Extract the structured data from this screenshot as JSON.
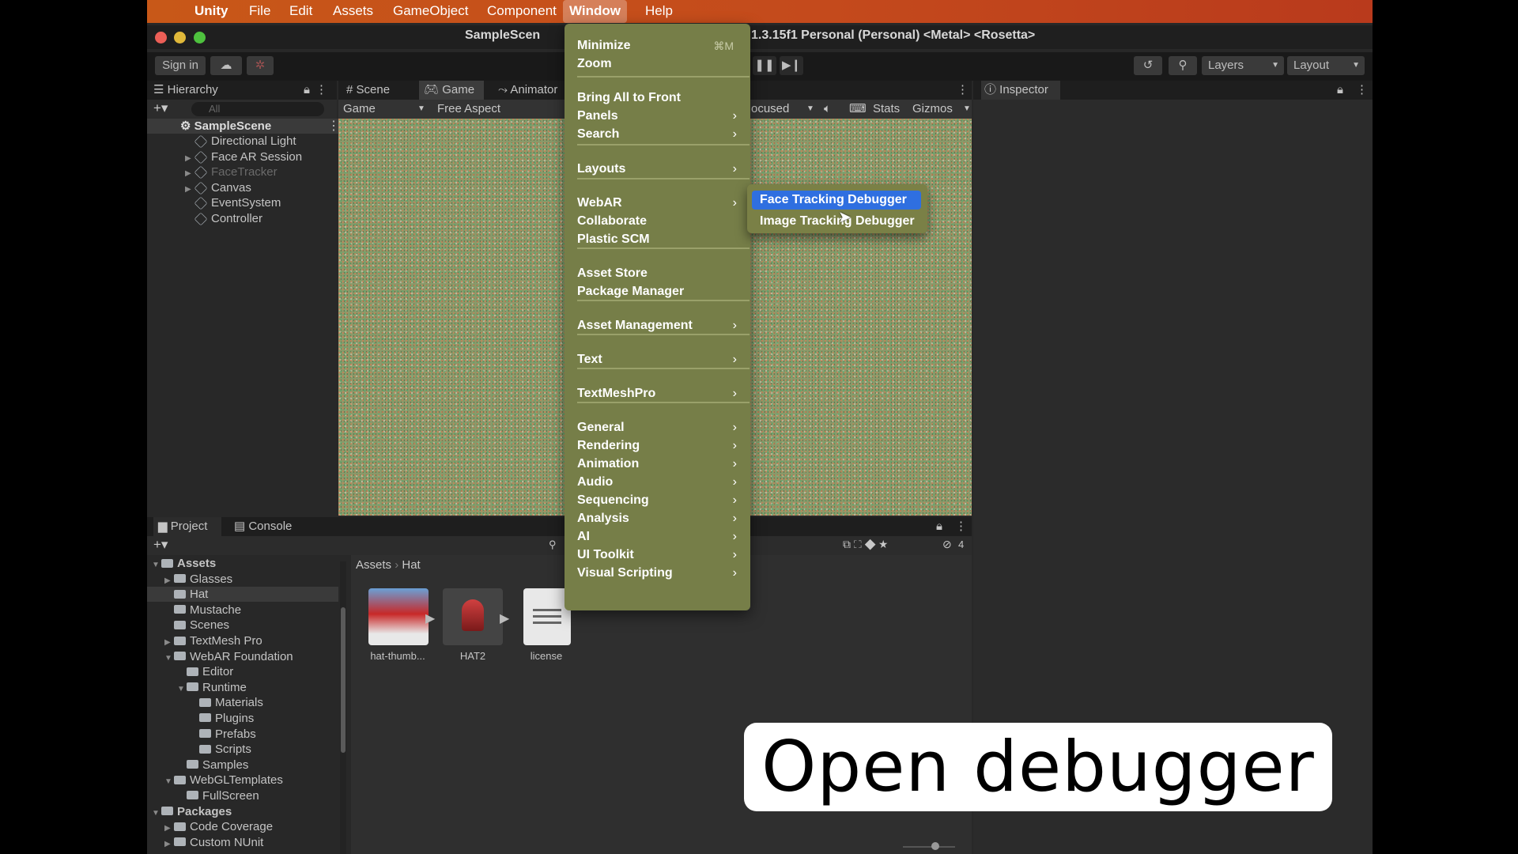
{
  "menubar": {
    "app": "Unity",
    "items": [
      "File",
      "Edit",
      "Assets",
      "GameObject",
      "Component",
      "Window",
      "Help"
    ]
  },
  "window": {
    "title_left": "SampleScen",
    "title_right": "1.3.15f1 Personal (Personal) <Metal> <Rosetta>"
  },
  "toolbar": {
    "sign_in": "Sign in",
    "layers": "Layers",
    "layout": "Layout"
  },
  "hierarchy": {
    "title": "Hierarchy",
    "search_placeholder": "All",
    "scene": "SampleScene",
    "items": [
      "Directional Light",
      "Face AR Session",
      "FaceTracker",
      "Canvas",
      "EventSystem",
      "Controller"
    ]
  },
  "scene_tabs": {
    "scene": "Scene",
    "game": "Game",
    "animator": "Animator",
    "game_dropdown": "Game",
    "aspect": "Free Aspect",
    "focused": "ocused",
    "stats": "Stats",
    "gizmos": "Gizmos"
  },
  "inspector": {
    "title": "Inspector"
  },
  "window_menu": {
    "items": [
      {
        "label": "Minimize",
        "shortcut": "⌘M"
      },
      {
        "label": "Zoom"
      },
      {
        "label": "Bring All to Front"
      },
      {
        "label": "Panels",
        "sub": true
      },
      {
        "label": "Search",
        "sub": true
      },
      {
        "label": "Layouts",
        "sub": true
      },
      {
        "label": "WebAR",
        "sub": true
      },
      {
        "label": "Collaborate"
      },
      {
        "label": "Plastic SCM"
      },
      {
        "label": "Asset Store"
      },
      {
        "label": "Package Manager"
      },
      {
        "label": "Asset Management",
        "sub": true
      },
      {
        "label": "Text",
        "sub": true
      },
      {
        "label": "TextMeshPro",
        "sub": true
      },
      {
        "label": "General",
        "sub": true
      },
      {
        "label": "Rendering",
        "sub": true
      },
      {
        "label": "Animation",
        "sub": true
      },
      {
        "label": "Audio",
        "sub": true
      },
      {
        "label": "Sequencing",
        "sub": true
      },
      {
        "label": "Analysis",
        "sub": true
      },
      {
        "label": "AI",
        "sub": true
      },
      {
        "label": "UI Toolkit",
        "sub": true
      },
      {
        "label": "Visual Scripting",
        "sub": true
      }
    ]
  },
  "webar_submenu": {
    "items": [
      "Face Tracking Debugger",
      "Image Tracking Debugger"
    ]
  },
  "project": {
    "tab_project": "Project",
    "tab_console": "Console",
    "breadcrumb": [
      "Assets",
      "Hat"
    ],
    "visible_count": "4",
    "tree": [
      {
        "label": "Assets",
        "depth": 0,
        "bold": true
      },
      {
        "label": "Glasses",
        "depth": 1
      },
      {
        "label": "Hat",
        "depth": 1
      },
      {
        "label": "Mustache",
        "depth": 1
      },
      {
        "label": "Scenes",
        "depth": 1
      },
      {
        "label": "TextMesh Pro",
        "depth": 1
      },
      {
        "label": "WebAR Foundation",
        "depth": 1
      },
      {
        "label": "Editor",
        "depth": 2
      },
      {
        "label": "Runtime",
        "depth": 2
      },
      {
        "label": "Materials",
        "depth": 3
      },
      {
        "label": "Plugins",
        "depth": 3
      },
      {
        "label": "Prefabs",
        "depth": 3
      },
      {
        "label": "Scripts",
        "depth": 3
      },
      {
        "label": "Samples",
        "depth": 2
      },
      {
        "label": "WebGLTemplates",
        "depth": 1
      },
      {
        "label": "FullScreen",
        "depth": 2
      },
      {
        "label": "Packages",
        "depth": 0,
        "bold": true
      },
      {
        "label": "Code Coverage",
        "depth": 1
      },
      {
        "label": "Custom NUnit",
        "depth": 1
      }
    ],
    "assets": [
      "hat-thumb...",
      "HAT2",
      "license"
    ]
  },
  "caption": "Open debugger"
}
